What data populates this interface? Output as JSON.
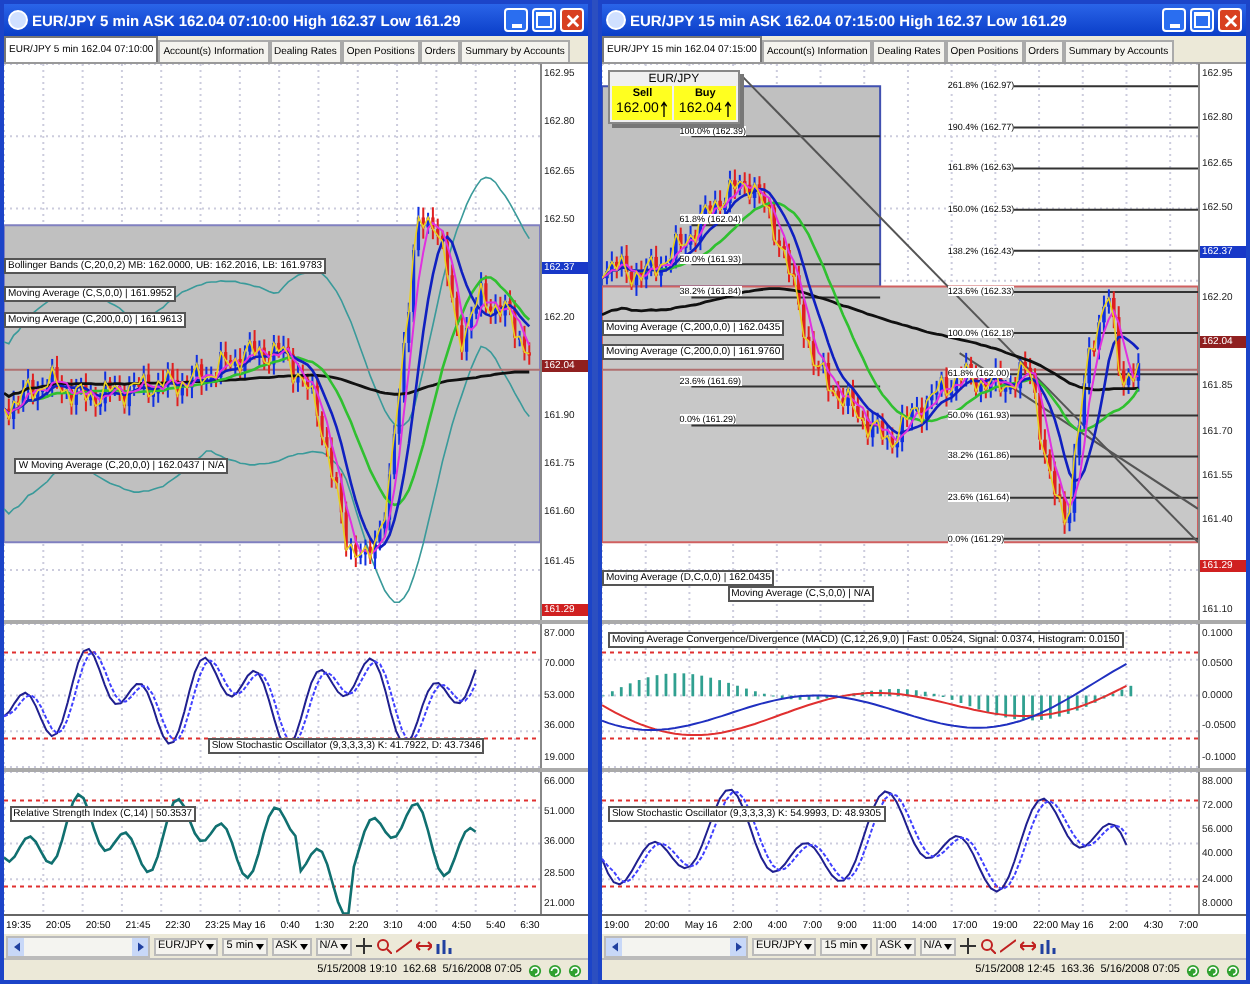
{
  "windows": [
    {
      "title": "EUR/JPY 5 min ASK 162.04 07:10:00 High 162.37 Low 161.29",
      "tabs": [
        {
          "label": "EUR/JPY 5 min 162.04 07:10:00",
          "selected": true
        },
        {
          "label": "Account(s) Information",
          "selected": false
        },
        {
          "label": "Dealing Rates",
          "selected": false
        },
        {
          "label": "Open Positions",
          "selected": false
        },
        {
          "label": "Orders",
          "selected": false
        },
        {
          "label": "Summary by Accounts",
          "selected": false
        }
      ],
      "panels": [
        {
          "kind": "price",
          "labels": [
            "Bollinger Bands (C,20,0,2) MB: 162.0000, UB: 162.2016, LB: 161.9783",
            "Moving Average (C,S,0,0) | 161.9952",
            "Moving Average (C,200,0,0) | 161.9613",
            "W Moving Average (C,20,0,0) | 162.0437 | N/A"
          ],
          "axis": [
            {
              "text": "162.95"
            },
            {
              "text": "162.80"
            },
            {
              "text": "162.65"
            },
            {
              "text": "162.50"
            },
            {
              "text": "162.37",
              "color": "#1838c8"
            },
            {
              "text": "162.20"
            },
            {
              "text": "162.04",
              "color": "#902020"
            },
            {
              "text": "161.90"
            },
            {
              "text": "161.75"
            },
            {
              "text": "161.60"
            },
            {
              "text": "161.45"
            },
            {
              "text": "161.29",
              "color": "#d02020"
            }
          ]
        },
        {
          "kind": "stochastic",
          "labels": [
            "Slow Stochastic Oscillator (9,3,3,3,3) K: 41.7922, D: 43.7346"
          ],
          "axis": [
            {
              "text": "87.000"
            },
            {
              "text": "70.000"
            },
            {
              "text": "53.000"
            },
            {
              "text": "36.000"
            },
            {
              "text": "19.000"
            }
          ]
        },
        {
          "kind": "rsi",
          "labels": [
            "Relative Strength Index (C,14) | 50.3537"
          ],
          "axis": [
            {
              "text": "66.000"
            },
            {
              "text": "51.000"
            },
            {
              "text": "36.000"
            },
            {
              "text": "28.500"
            },
            {
              "text": "21.000"
            }
          ]
        }
      ],
      "time_axis": [
        "19:35",
        "20:05",
        "20:50",
        "21:45",
        "22:30",
        "23:25 May 16",
        "0:40",
        "1:30",
        "2:20",
        "3:10",
        "4:00",
        "4:50",
        "5:40",
        "6:30"
      ],
      "toolbar": [
        "EUR/JPY",
        "5 min",
        "ASK",
        "N/A"
      ],
      "status": {
        "start": "5/15/2008 19:10",
        "price": "162.68",
        "end": "5/16/2008 07:05"
      }
    },
    {
      "title": "EUR/JPY 15 min ASK 162.04 07:15:00 High 162.37 Low 161.29",
      "tabs": [
        {
          "label": "EUR/JPY 15 min 162.04 07:15:00",
          "selected": true
        },
        {
          "label": "Account(s) Information",
          "selected": false
        },
        {
          "label": "Dealing Rates",
          "selected": false
        },
        {
          "label": "Open Positions",
          "selected": false
        },
        {
          "label": "Orders",
          "selected": false
        },
        {
          "label": "Summary by Accounts",
          "selected": false
        }
      ],
      "quote": {
        "symbol": "EUR/JPY",
        "sell_label": "Sell",
        "buy_label": "Buy",
        "sell": "162.00",
        "buy": "162.04"
      },
      "panels": [
        {
          "kind": "price",
          "labels": [
            "Moving Average (C,200,0,0) | 162.0435",
            "Moving Average (C,200,0,0) | 161.9760",
            "Moving Average (D,C,0,0) | 162.0435",
            "Moving Average (C,S,0,0) | N/A"
          ],
          "fib_left": [
            "100.0% (162.39)",
            "61.8% (162.04)",
            "50.0% (161.93)",
            "38.2% (161.84)",
            "23.6% (161.69)",
            "0.0% (161.29)"
          ],
          "fib_right": [
            "261.8% (162.97)",
            "190.4% (162.77)",
            "161.8% (162.63)",
            "150.0% (162.53)",
            "138.2% (162.43)",
            "123.6% (162.33)",
            "100.0% (162.18)",
            "61.8% (162.00)",
            "50.0% (161.93)",
            "38.2% (161.86)",
            "23.6% (161.64)",
            "0.0% (161.29)"
          ],
          "axis": [
            {
              "text": "162.95"
            },
            {
              "text": "162.80"
            },
            {
              "text": "162.65"
            },
            {
              "text": "162.50"
            },
            {
              "text": "162.37",
              "color": "#1838c8"
            },
            {
              "text": "162.20"
            },
            {
              "text": "162.04",
              "color": "#902020"
            },
            {
              "text": "161.85"
            },
            {
              "text": "161.70"
            },
            {
              "text": "161.55"
            },
            {
              "text": "161.40"
            },
            {
              "text": "161.29",
              "color": "#d02020"
            },
            {
              "text": "161.10"
            }
          ]
        },
        {
          "kind": "macd",
          "labels": [
            "Moving Average Convergence/Divergence (MACD) (C,12,26,9,0) | Fast: 0.0524, Signal: 0.0374, Histogram: 0.0150"
          ],
          "axis": [
            {
              "text": "0.1000"
            },
            {
              "text": "0.0500"
            },
            {
              "text": "0.0000"
            },
            {
              "text": "-0.0500"
            },
            {
              "text": "-0.1000"
            }
          ]
        },
        {
          "kind": "stochastic",
          "labels": [
            "Slow Stochastic Oscillator (9,3,3,3,3) K: 54.9993, D: 48.9305"
          ],
          "axis": [
            {
              "text": "88.000"
            },
            {
              "text": "72.000"
            },
            {
              "text": "56.000"
            },
            {
              "text": "40.000"
            },
            {
              "text": "24.000"
            },
            {
              "text": "8.0000"
            }
          ]
        }
      ],
      "time_axis": [
        "19:00",
        "20:00",
        "May 16",
        "2:00",
        "4:00",
        "7:00",
        "9:00",
        "11:00",
        "14:00",
        "17:00",
        "19:00",
        "22:00 May 16",
        "2:00",
        "4:30",
        "7:00"
      ],
      "toolbar": [
        "EUR/JPY",
        "15 min",
        "ASK",
        "N/A"
      ],
      "status": {
        "start": "5/15/2008 12:45",
        "price": "163.36",
        "end": "5/16/2008 07:05"
      }
    }
  ]
}
